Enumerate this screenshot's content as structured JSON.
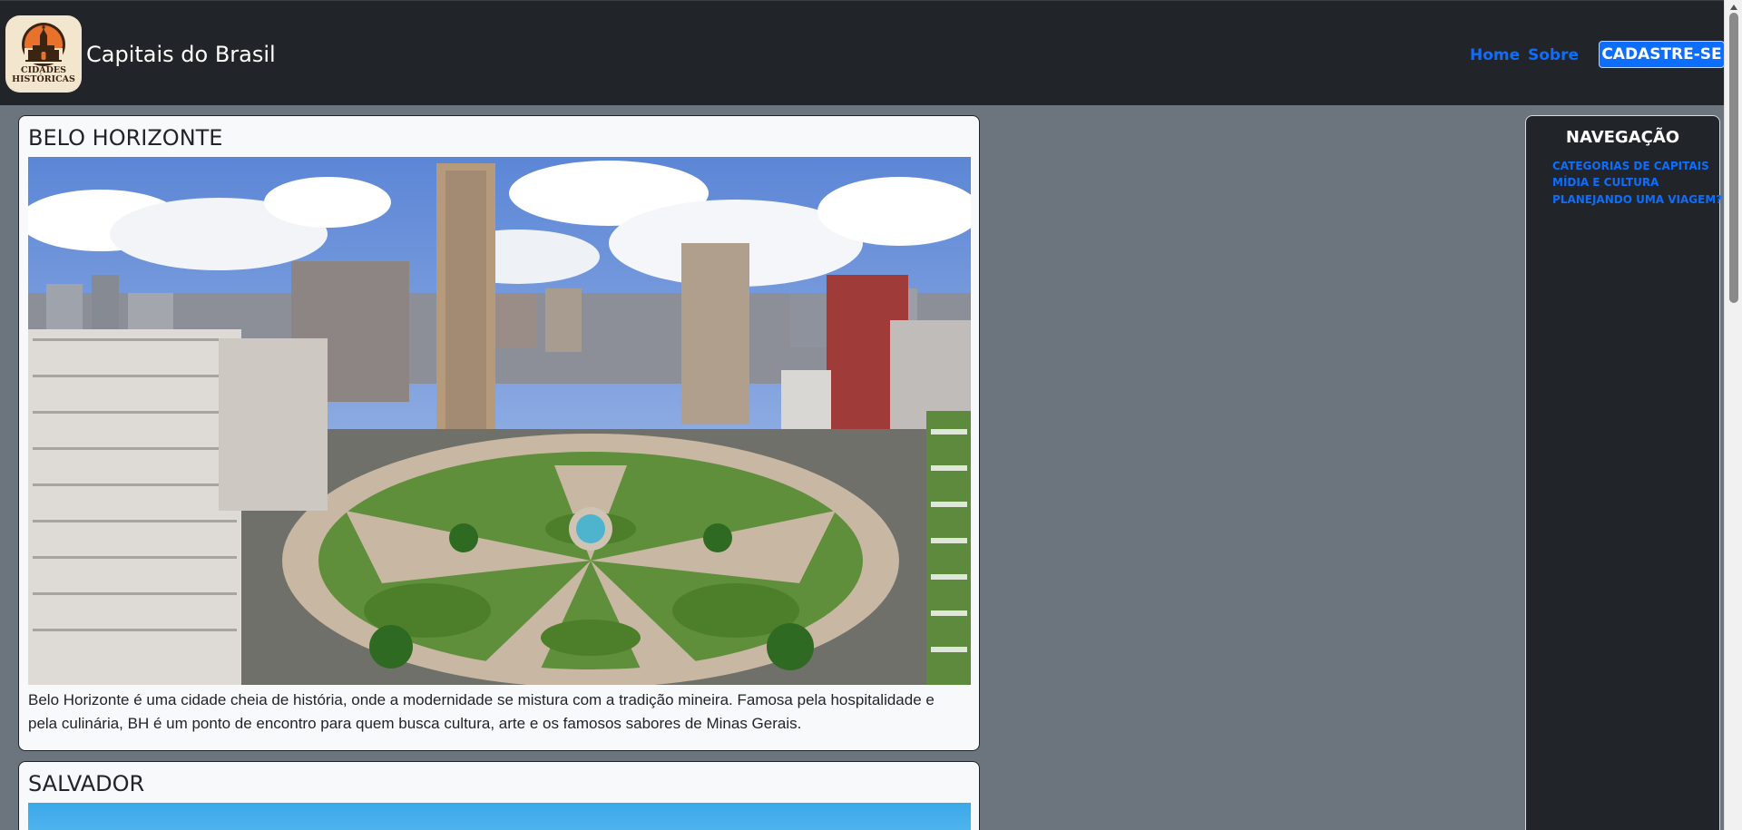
{
  "header": {
    "logo": {
      "line1": "CIDADES",
      "line2": "HISTÓRICAS",
      "icon": "church-sunset-logo-icon"
    },
    "title": "Capitais do Brasil",
    "nav": {
      "home": "Home",
      "sobre": "Sobre"
    },
    "cta": "CADASTRE-SE"
  },
  "cards": [
    {
      "title": "BELO HORIZONTE",
      "image": "belo-horizonte-aerial-photo",
      "text": "Belo Horizonte é uma cidade cheia de história, onde a modernidade se mistura com a tradição mineira. Famosa pela hospitalidade e pela culinária, BH é um ponto de encontro para quem busca cultura, arte e os famosos sabores de Minas Gerais."
    },
    {
      "title": "SALVADOR",
      "image": "salvador-photo"
    }
  ],
  "sidebar": {
    "title": "NAVEGAÇÃO",
    "links": [
      "CATEGORIAS DE CAPITAIS",
      "MÍDIA E CULTURA",
      "PLANEJANDO UMA VIAGEM?"
    ]
  },
  "colors": {
    "header_bg": "#212529",
    "page_bg": "#6c757d",
    "accent": "#0d6efd",
    "card_bg": "#f8f9fa"
  }
}
